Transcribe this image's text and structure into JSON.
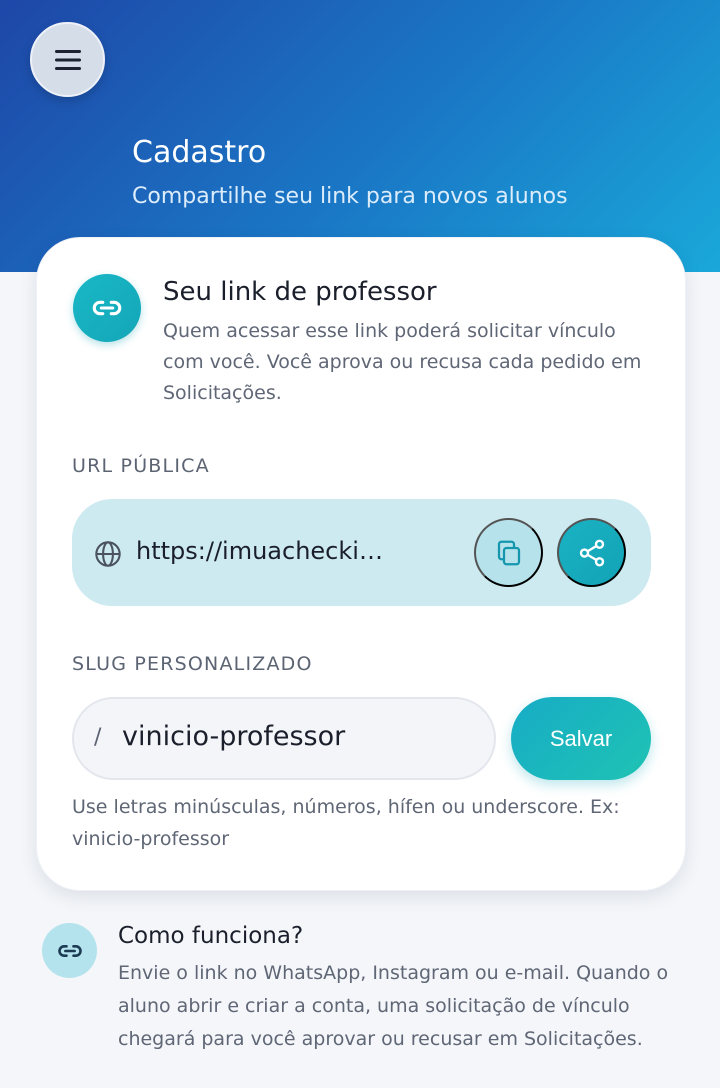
{
  "header": {
    "menu_icon": "hamburger-menu-icon",
    "title": "Cadastro",
    "subtitle": "Compartilhe seu link para novos alunos"
  },
  "link_card": {
    "icon": "link-icon",
    "title": "Seu link de professor",
    "description": "Quem acessar esse link poderá solicitar vínculo com você. Você aprova ou recusa cada pedido em Solicitações.",
    "url_section": {
      "label": "URL PÚBLICA",
      "url": "https://imuacheckin.com....",
      "globe_icon": "globe-icon",
      "copy_icon": "copy-icon",
      "share_icon": "share-icon"
    },
    "slug_section": {
      "label": "SLUG PERSONALIZADO",
      "prefix": "/",
      "value": "vinicio-professor",
      "save_label": "Salvar",
      "help": "Use letras minúsculas, números, hífen ou underscore. Ex: vinicio-professor"
    }
  },
  "how_it_works": {
    "icon": "link-icon",
    "title": "Como funciona?",
    "description": "Envie o link no WhatsApp, Instagram ou e-mail. Quando o aluno abrir e criar a conta, uma solicitação de vínculo chegará para você aprovar ou recusar em Solicitações."
  },
  "colors": {
    "header_gradient_start": "#1e47a8",
    "header_gradient_end": "#1aa8d9",
    "accent_teal": "#14a6b8",
    "url_box_bg": "#cdeaf0"
  }
}
